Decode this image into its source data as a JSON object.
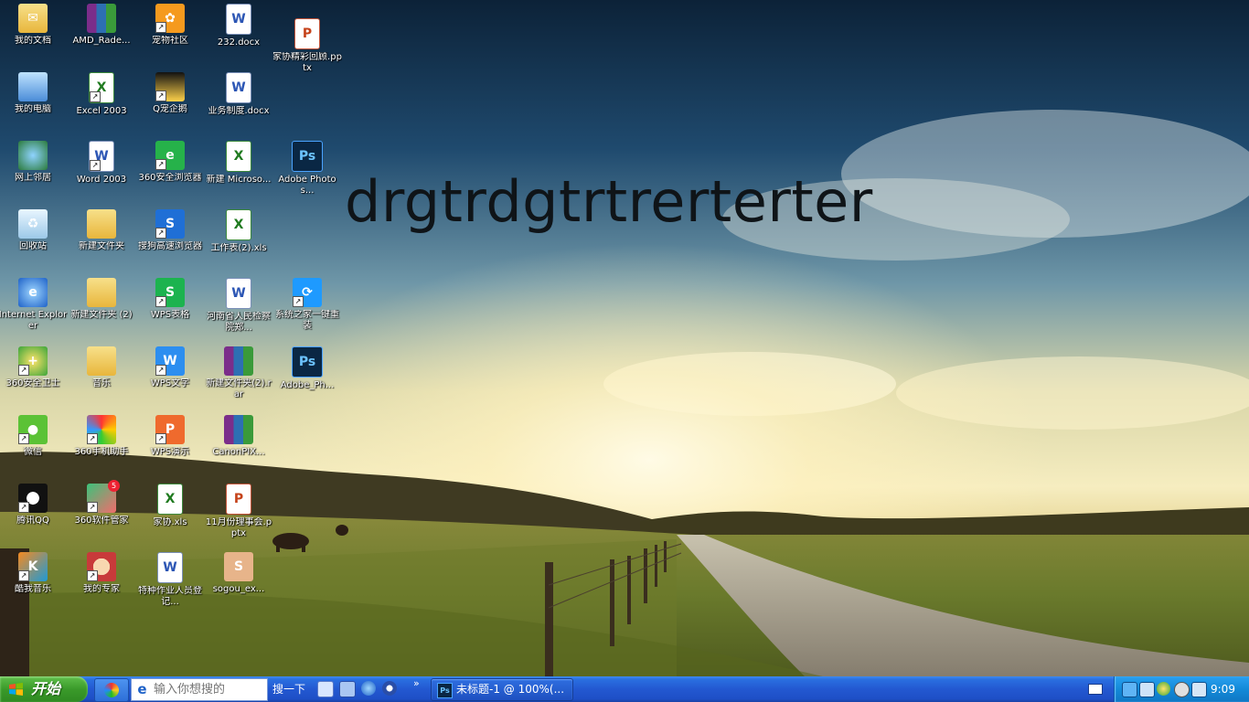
{
  "desktop": {
    "overlay_text": "drgtrdgtrtrerterter",
    "icons": [
      {
        "label": "我的文档",
        "type": "folder-docs",
        "shortcut": false
      },
      {
        "label": "我的电脑",
        "type": "computer",
        "shortcut": false
      },
      {
        "label": "网上邻居",
        "type": "network",
        "shortcut": false
      },
      {
        "label": "回收站",
        "type": "recycle-bin",
        "shortcut": false
      },
      {
        "label": "Internet Explorer",
        "type": "ie",
        "shortcut": false
      },
      {
        "label": "360安全卫士",
        "type": "360-guard",
        "shortcut": true
      },
      {
        "label": "微信",
        "type": "wechat",
        "shortcut": true
      },
      {
        "label": "腾讯QQ",
        "type": "qq",
        "shortcut": true
      },
      {
        "label": "酷我音乐",
        "type": "kuwo-music",
        "shortcut": true
      },
      {
        "label": "AMD_Rade...",
        "type": "winrar",
        "shortcut": false
      },
      {
        "label": "Excel 2003",
        "type": "excel-2003",
        "shortcut": true
      },
      {
        "label": "Word 2003",
        "type": "word-2003",
        "shortcut": true
      },
      {
        "label": "新建文件夹",
        "type": "folder",
        "shortcut": false
      },
      {
        "label": "新建文件夹 (2)",
        "type": "folder",
        "shortcut": false
      },
      {
        "label": "音乐",
        "type": "folder",
        "shortcut": false
      },
      {
        "label": "360手机助手",
        "type": "360-phone",
        "shortcut": true
      },
      {
        "label": "360软件管家",
        "type": "360-software",
        "shortcut": true,
        "badge": "5"
      },
      {
        "label": "我的专家",
        "type": "expert",
        "shortcut": true
      },
      {
        "label": "宠物社区",
        "type": "pet",
        "shortcut": true
      },
      {
        "label": "Q宠企鹅",
        "type": "penguin",
        "shortcut": true
      },
      {
        "label": "360安全浏览器",
        "type": "360-browser",
        "shortcut": true
      },
      {
        "label": "搜狗高速浏览器",
        "type": "sogou-browser",
        "shortcut": true
      },
      {
        "label": "WPS表格",
        "type": "wps-sheet",
        "shortcut": true
      },
      {
        "label": "WPS文字",
        "type": "wps-writer",
        "shortcut": true
      },
      {
        "label": "WPS演示",
        "type": "wps-present",
        "shortcut": true
      },
      {
        "label": "家协.xls",
        "type": "xls",
        "shortcut": false
      },
      {
        "label": "特种作业人员登记...",
        "type": "doc",
        "shortcut": false
      },
      {
        "label": "232.docx",
        "type": "doc",
        "shortcut": false
      },
      {
        "label": "业务制度.docx",
        "type": "doc",
        "shortcut": false
      },
      {
        "label": "新建 Microso...",
        "type": "xls",
        "shortcut": false
      },
      {
        "label": "工作表(2).xls",
        "type": "xls",
        "shortcut": false
      },
      {
        "label": "河南省人民检察院郑...",
        "type": "doc",
        "shortcut": false
      },
      {
        "label": "新建文件夹(2).rar",
        "type": "winrar",
        "shortcut": false
      },
      {
        "label": "CanonPIX...",
        "type": "winrar",
        "shortcut": false
      },
      {
        "label": "11月份理事会.pptx",
        "type": "ppt",
        "shortcut": false
      },
      {
        "label": "sogou_ex...",
        "type": "sogou-ex",
        "shortcut": false
      },
      {
        "label": "家协精彩回顾.pptx",
        "type": "ppt",
        "shortcut": false
      },
      {
        "label": "Adobe Photos...",
        "type": "photoshop",
        "shortcut": false
      },
      {
        "label": "系统之家一键重装",
        "type": "system-reinstall",
        "shortcut": true
      },
      {
        "label": "Adobe_Ph...",
        "type": "photoshop",
        "shortcut": false
      }
    ]
  },
  "taskbar": {
    "start_label": "开始",
    "search": {
      "placeholder": "输入你想搜的",
      "button_label": "搜一下"
    },
    "quicklaunch_more": "»",
    "tasks": [
      {
        "label": "未标题-1 @ 100%(...",
        "icon": "photoshop"
      }
    ],
    "clock": "9:09",
    "tray_icons": [
      "network-icon",
      "volume-icon",
      "360-guard-icon",
      "sync-icon",
      "usb-icon"
    ]
  },
  "colors": {
    "taskbar_blue": "#2358d1",
    "start_green": "#3a9a2a",
    "tray_blue": "#138ad8"
  }
}
